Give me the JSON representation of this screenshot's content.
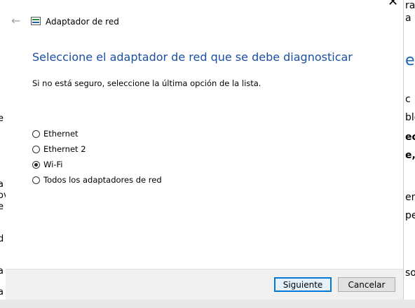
{
  "window": {
    "title": "Adaptador de red"
  },
  "page": {
    "heading": "Seleccione el adaptador de red que se debe diagnosticar",
    "instruction": "Si no está seguro, seleccione la última opción de la lista."
  },
  "options": [
    {
      "label": "Ethernet",
      "checked": false
    },
    {
      "label": "Ethernet 2",
      "checked": false
    },
    {
      "label": "Wi-Fi",
      "checked": true
    },
    {
      "label": "Todos los adaptadores de red",
      "checked": false
    }
  ],
  "buttons": {
    "next": "Siguiente",
    "cancel": "Cancelar"
  },
  "background": {
    "right_fragments": [
      "ra",
      "a",
      "e",
      "c",
      "ble",
      "ect",
      "e,",
      "em",
      "pe",
      "sos"
    ],
    "left_fragments": [
      "e",
      "a",
      "ov",
      "e",
      "d",
      "a",
      "a"
    ],
    "close_glyph": "✕"
  },
  "icons": {
    "back": "back-arrow-icon",
    "app": "network-adapter-icon"
  }
}
